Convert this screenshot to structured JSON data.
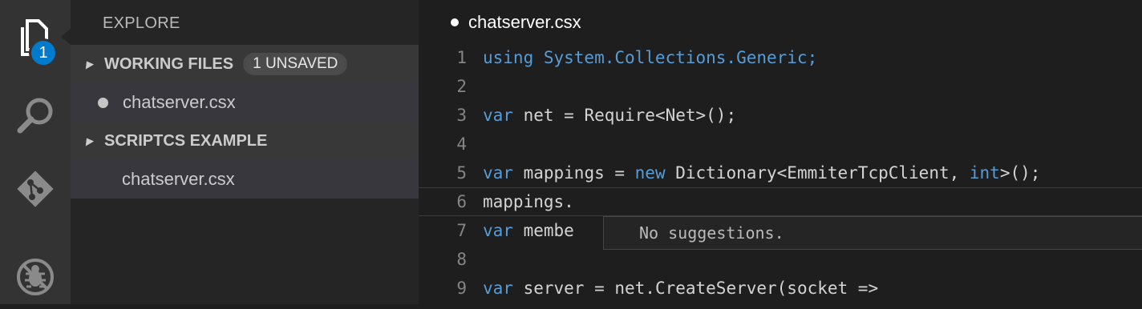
{
  "activity_bar": {
    "explorer_badge": "1"
  },
  "sidebar": {
    "title": "EXPLORE",
    "working_files": {
      "label": "WORKING FILES",
      "badge": "1 UNSAVED",
      "files": [
        "chatserver.csx"
      ]
    },
    "project": {
      "label": "SCRIPTCS EXAMPLE",
      "files": [
        "chatserver.csx"
      ]
    }
  },
  "editor": {
    "tab_title": "chatserver.csx",
    "lines": [
      {
        "num": "1",
        "parts": [
          {
            "t": "using System.Collections.Generic;",
            "k": true
          }
        ]
      },
      {
        "num": "2",
        "parts": []
      },
      {
        "num": "3",
        "parts": [
          {
            "t": "var",
            "k": true
          },
          {
            "t": " net = Require<Net>();",
            "k": false
          }
        ]
      },
      {
        "num": "4",
        "parts": []
      },
      {
        "num": "5",
        "parts": [
          {
            "t": "var",
            "k": true
          },
          {
            "t": " mappings = ",
            "k": false
          },
          {
            "t": "new",
            "k": true
          },
          {
            "t": " Dictionary<EmmiterTcpClient, ",
            "k": false
          },
          {
            "t": "int",
            "k": true
          },
          {
            "t": ">();",
            "k": false
          }
        ]
      },
      {
        "num": "6",
        "parts": [
          {
            "t": "mappings.",
            "k": false
          }
        ]
      },
      {
        "num": "7",
        "parts": [
          {
            "t": "var",
            "k": true
          },
          {
            "t": " membe",
            "k": false
          }
        ]
      },
      {
        "num": "8",
        "parts": []
      },
      {
        "num": "9",
        "parts": [
          {
            "t": "var",
            "k": true
          },
          {
            "t": " server = net.CreateServer(socket =>",
            "k": false
          }
        ]
      }
    ],
    "suggest_text": "No suggestions."
  },
  "colors": {
    "keyword": "#569cd6",
    "badge": "#007acc"
  },
  "icons": [
    "files-icon",
    "search-icon",
    "git-icon",
    "debug-icon"
  ]
}
